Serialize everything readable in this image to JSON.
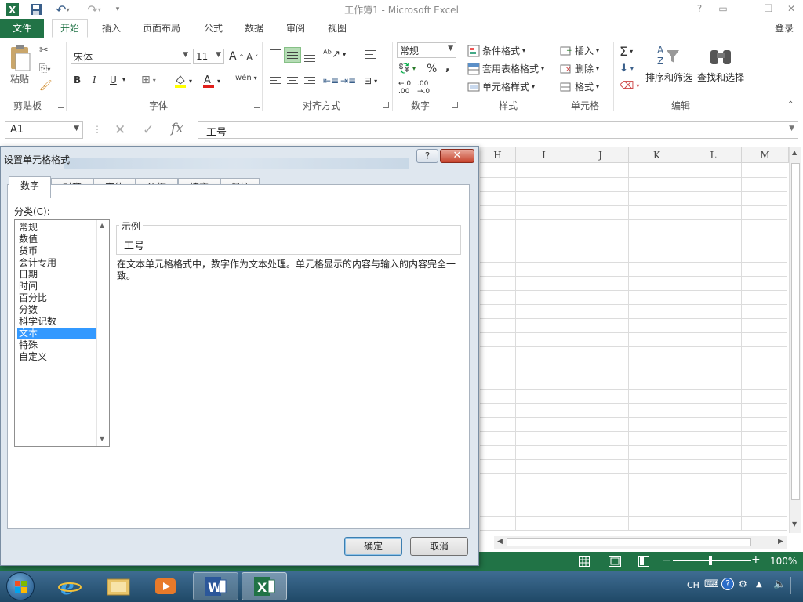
{
  "window": {
    "title": "工作簿1 - Microsoft Excel",
    "login": "登录",
    "help": "?"
  },
  "tabs": [
    {
      "label": "文件"
    },
    {
      "label": "开始"
    },
    {
      "label": "插入"
    },
    {
      "label": "页面布局"
    },
    {
      "label": "公式"
    },
    {
      "label": "数据"
    },
    {
      "label": "审阅"
    },
    {
      "label": "视图"
    }
  ],
  "ribbon": {
    "clipboard": {
      "paste": "粘贴",
      "label": "剪贴板"
    },
    "font": {
      "name": "宋体",
      "size": "11",
      "bold": "B",
      "italic": "I",
      "underline": "U",
      "phonetic": "wén",
      "label": "字体"
    },
    "alignment": {
      "label": "对齐方式"
    },
    "number": {
      "format": "常规",
      "percent": "%",
      "comma": ",",
      "label": "数字"
    },
    "styles": {
      "conditional": "条件格式",
      "table": "套用表格格式",
      "cell": "单元格样式",
      "label": "样式"
    },
    "cells": {
      "insert": "插入",
      "delete": "删除",
      "format": "格式",
      "label": "单元格"
    },
    "editing": {
      "sort": "排序和筛选",
      "find": "查找和选择",
      "label": "编辑"
    }
  },
  "formula_bar": {
    "name_box": "A1",
    "value": "工号",
    "fx": "fx"
  },
  "columns": [
    "H",
    "I",
    "J",
    "K",
    "L",
    "M"
  ],
  "status": {
    "zoom": "100%"
  },
  "dialog": {
    "title": "设置单元格格式",
    "tabs": [
      "数字",
      "对齐",
      "字体",
      "边框",
      "填充",
      "保护"
    ],
    "category_label": "分类(C):",
    "categories": [
      "常规",
      "数值",
      "货币",
      "会计专用",
      "日期",
      "时间",
      "百分比",
      "分数",
      "科学记数",
      "文本",
      "特殊",
      "自定义"
    ],
    "selected_category": "文本",
    "sample_label": "示例",
    "sample_value": "工号",
    "description": "在文本单元格格式中，数字作为文本处理。单元格显示的内容与输入的内容完全一致。",
    "ok": "确定",
    "cancel": "取消"
  },
  "taskbar": {
    "lang": "CH"
  },
  "colors": {
    "excel_green": "#217346",
    "selection": "#3399ff"
  }
}
